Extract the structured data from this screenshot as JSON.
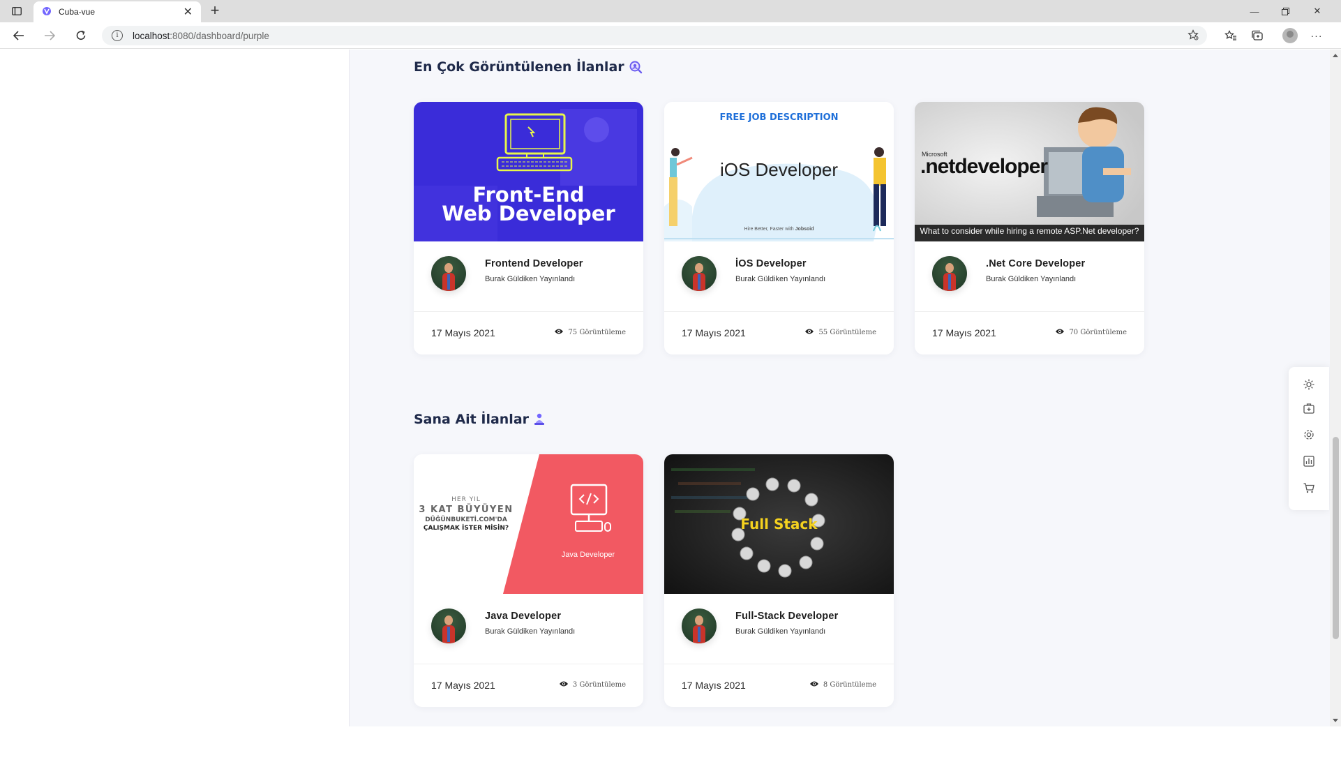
{
  "browser": {
    "tab_title": "Cuba-vue",
    "url_host": "localhost",
    "url_rest": ":8080/dashboard/purple"
  },
  "colors": {
    "accent": "#7366ff",
    "frontend_bg": "#3a2cd9",
    "java_red": "#f25962",
    "page_bg": "#f6f7fb"
  },
  "sections": [
    {
      "title": "En Çok Görüntülenen İlanlar",
      "icon": "search-emoji-icon",
      "cards": [
        {
          "title": "Frontend Developer",
          "subtitle": "Burak Güldiken Yayınlandı",
          "date": "17 Mayıs 2021",
          "views": "75 Görüntüleme",
          "image": "frontend",
          "image_text": [
            "Front-End",
            "Web Developer"
          ]
        },
        {
          "title": "İOS Developer",
          "subtitle": "Burak Güldiken Yayınlandı",
          "date": "17 Mayıs 2021",
          "views": "55 Görüntüleme",
          "image": "ios",
          "image_text": [
            "FREE JOB DESCRIPTION",
            "iOS Developer",
            "Hire Better, Faster with",
            "Jobsoid"
          ]
        },
        {
          "title": ".Net Core Developer",
          "subtitle": "Burak Güldiken Yayınlandı",
          "date": "17 Mayıs 2021",
          "views": "70 Görüntüleme",
          "image": "dotnet",
          "image_text": [
            "Microsoft",
            ".netdeveloper",
            "What to consider while hiring a remote ASP.Net developer?"
          ]
        }
      ]
    },
    {
      "title": "Sana Ait İlanlar",
      "icon": "person-emoji-icon",
      "cards": [
        {
          "title": "Java Developer",
          "subtitle": "Burak Güldiken Yayınlandı",
          "date": "17 Mayıs 2021",
          "views": "3 Görüntüleme",
          "image": "java",
          "image_text": [
            "HER YIL",
            "3 KAT BÜYÜYEN",
            "DÜĞÜNBUKETİ.COM'DA",
            "ÇALIŞMAK İSTER MİSİN?",
            "Java Developer"
          ]
        },
        {
          "title": "Full-Stack Developer",
          "subtitle": "Burak Güldiken Yayınlandı",
          "date": "17 Mayıs 2021",
          "views": "8 Görüntüleme",
          "image": "fullstack",
          "image_text": [
            "Full Stack"
          ]
        }
      ]
    }
  ],
  "float_tools": [
    "settings-icon",
    "briefcase-add-icon",
    "gear-icon",
    "chart-icon",
    "cart-icon"
  ]
}
